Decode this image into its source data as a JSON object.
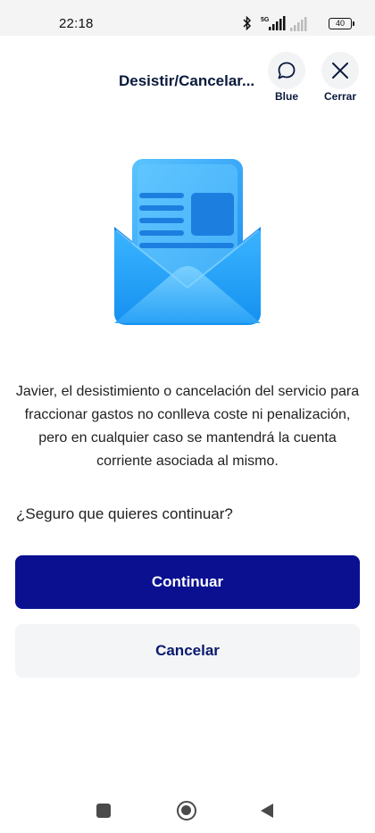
{
  "status_bar": {
    "time": "22:18",
    "network_label": "5G",
    "battery": "40",
    "icons": [
      "bluetooth-icon",
      "signal-5g-icon",
      "signal-icon",
      "battery-icon"
    ]
  },
  "header": {
    "title": "Desistir/Cancelar...",
    "chat_label": "Blue",
    "close_label": "Cerrar"
  },
  "content": {
    "illustration": "envelope-document-icon",
    "message": "Javier, el desistimiento o cancelación del servicio para fraccionar gastos no conlleva coste ni penalización, pero en cualquier caso se mantendrá la cuenta corriente asociada al mismo.",
    "question": "¿Seguro que quieres continuar?"
  },
  "buttons": {
    "continue_label": "Continuar",
    "cancel_label": "Cancelar"
  },
  "colors": {
    "primary": "#0a1090",
    "title": "#0a1a3c",
    "secondary_bg": "#f4f5f6",
    "illustration": "#1a9cf5"
  },
  "nav_bar": {
    "icons": [
      "recents-square-icon",
      "home-circle-icon",
      "back-triangle-icon"
    ]
  }
}
